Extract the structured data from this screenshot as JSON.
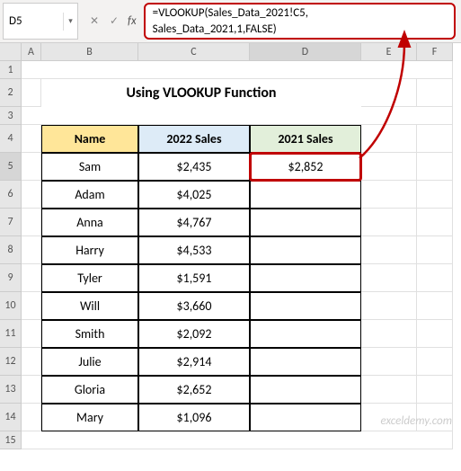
{
  "name_box": "D5",
  "formula": "=VLOOKUP(Sales_Data_2021!C5,\nSales_Data_2021,1,FALSE)",
  "fx_label": "fx",
  "cancel_glyph": "✕",
  "confirm_glyph": "✓",
  "dropdown_glyph": "▾",
  "columns": [
    "A",
    "B",
    "C",
    "D",
    "E",
    "F"
  ],
  "rows": [
    "1",
    "2",
    "3",
    "4",
    "5",
    "6",
    "7",
    "8",
    "9",
    "10",
    "11",
    "12",
    "13",
    "14",
    "15"
  ],
  "title": "Using VLOOKUP Function",
  "headers": {
    "name": "Name",
    "sales_2022": "2022 Sales",
    "sales_2021": "2021 Sales"
  },
  "selected_value": "$2,852",
  "chart_data": {
    "type": "table",
    "title": "Using VLOOKUP Function",
    "columns": [
      "Name",
      "2022 Sales",
      "2021 Sales"
    ],
    "rows": [
      {
        "name": "Sam",
        "sales_2022": "$2,435",
        "sales_2021": "$2,852"
      },
      {
        "name": "Adam",
        "sales_2022": "$4,025",
        "sales_2021": ""
      },
      {
        "name": "Anna",
        "sales_2022": "$4,767",
        "sales_2021": ""
      },
      {
        "name": "Harry",
        "sales_2022": "$4,533",
        "sales_2021": ""
      },
      {
        "name": "Tyler",
        "sales_2022": "$1,591",
        "sales_2021": ""
      },
      {
        "name": "Will",
        "sales_2022": "$3,660",
        "sales_2021": ""
      },
      {
        "name": "Smith",
        "sales_2022": "$2,092",
        "sales_2021": ""
      },
      {
        "name": "Julie",
        "sales_2022": "$2,914",
        "sales_2021": ""
      },
      {
        "name": "Gloria",
        "sales_2022": "$2,652",
        "sales_2021": ""
      },
      {
        "name": "Mary",
        "sales_2022": "$1,096",
        "sales_2021": ""
      }
    ]
  },
  "watermark": "exceldemy.com"
}
